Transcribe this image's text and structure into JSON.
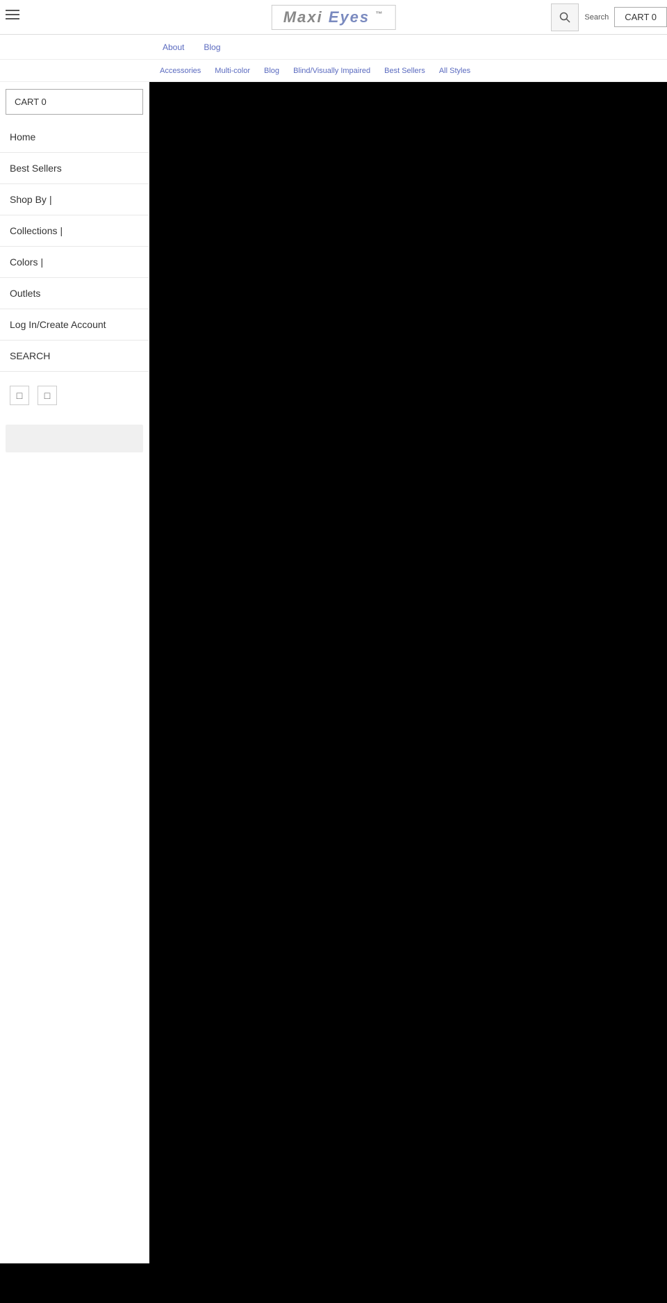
{
  "header": {
    "logo_maxi": "Maxi",
    "logo_eyes": "Eyes",
    "logo_trademark": "™",
    "search_label": "Search",
    "cart_label": "CART 0"
  },
  "top_nav": {
    "items": [
      {
        "label": "About"
      },
      {
        "label": "Blog"
      }
    ]
  },
  "sub_nav": {
    "items": [
      {
        "label": "Accessories"
      },
      {
        "label": "Multi-color"
      },
      {
        "label": "Blog"
      },
      {
        "label": "Blind/Visually Impaired"
      },
      {
        "label": "Best Sellers"
      },
      {
        "label": "All Styles"
      }
    ]
  },
  "sidebar": {
    "cart_label": "CART 0",
    "items": [
      {
        "label": "Home"
      },
      {
        "label": "Best Sellers"
      },
      {
        "label": "Shop By",
        "cursor": true
      },
      {
        "label": "Collections",
        "cursor": true
      },
      {
        "label": "Colors",
        "cursor": true
      },
      {
        "label": "Outlets"
      },
      {
        "label": "Log In/Create Account"
      },
      {
        "label": "SEARCH"
      }
    ],
    "social_icons": [
      {
        "icon": "□",
        "name": "facebook-icon"
      },
      {
        "icon": "□",
        "name": "instagram-icon"
      }
    ]
  }
}
